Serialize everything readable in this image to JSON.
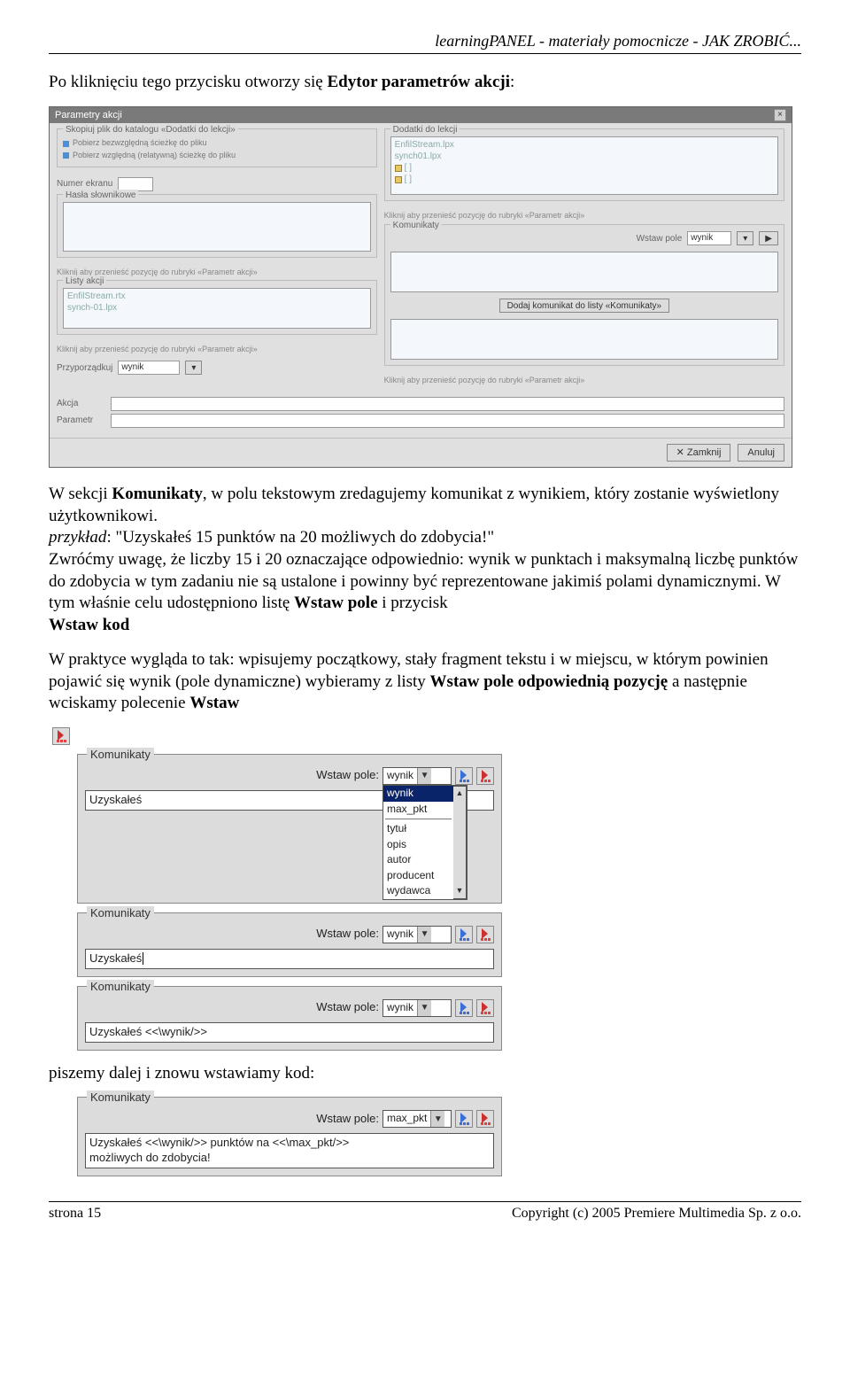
{
  "header": "learningPANEL - materiały pomocnicze - JAK ZROBIĆ...",
  "p1_a": "Po kliknięciu tego przycisku otworzy się ",
  "p1_b": "Edytor parametrów akcji",
  "p1_c": ":",
  "editor": {
    "title": "Parametry akcji",
    "close": "×",
    "left": {
      "g1_legend": "Skopiuj plik do katalogu «Dodatki do lekcji»",
      "g1_item1": "Pobierz bezwzględną ścieżkę do pliku",
      "g1_item2": "Pobierz względną (relatywną) ścieżkę do pliku",
      "numer_label": "Numer ekranu",
      "hasla_legend": "Hasła słownikowe",
      "hint_param": "Kliknij aby przenieść pozycję do rubryki «Parametr akcji»",
      "listy_legend": "Listy akcji",
      "listy_i1": "EnfilStream.rtx",
      "listy_i2": "synch-01.lpx",
      "przyp_label": "Przyporządkuj",
      "przyp_val": "wynik"
    },
    "right": {
      "dodatki_legend": "Dodatki do lekcji",
      "d_i1": "EnfilStream.lpx",
      "d_i2": "synch01.lpx",
      "d_i3": "[ ]",
      "d_i4": "[ ]",
      "hint_param": "Kliknij aby przenieść pozycję do rubryki «Parametr akcji»",
      "kom_legend": "Komunikaty",
      "wstaw_label": "Wstaw pole",
      "wstaw_val": "wynik",
      "dodaj_btn": "Dodaj komunikat do listy «Komunikaty»"
    },
    "bottom": {
      "akcja": "Akcja",
      "parametr": "Parametr",
      "cancel": "✕ Zamknij",
      "ok": "Anuluj"
    }
  },
  "p2_a": "W sekcji ",
  "p2_b": "Komunikaty",
  "p2_c": ", w polu tekstowym zredagujemy komunikat z wynikiem, który zostanie wyświetlony użytkownikowi.",
  "p3_a": "przykład",
  "p3_b": ": \"Uzyskałeś 15 punktów na 20 możliwych do zdobycia!\"",
  "p4": "Zwróćmy uwagę, że liczby 15 i 20 oznaczające odpowiednio: wynik w punktach i maksymalną liczbę punktów do zdobycia w tym zadaniu nie są ustalone i powinny być reprezentowane jakimiś polami dynamicznymi. W tym właśnie celu udostępniono listę ",
  "p4_b": "Wstaw pole",
  "p4_c": " i przycisk ",
  "p4_d": "Wstaw kod",
  "p5": "W praktyce wygląda to tak: wpisujemy początkowy, stały fragment tekstu i w miejscu, w którym powinien pojawić się wynik (pole dynamiczne) wybieramy z listy ",
  "p5_b": "Wstaw pole odpowiednią pozycję",
  "p5_c": " a  następnie wciskamy polecenie ",
  "p5_d": "Wstaw",
  "panel1": {
    "legend": "Komunikaty",
    "label": "Wstaw pole:",
    "sel": "wynik",
    "text": "Uzyskałeś",
    "opts": [
      "wynik",
      "max_pkt",
      "--sep--",
      "tytuł",
      "opis",
      "autor",
      "producent",
      "wydawca"
    ]
  },
  "panel2": {
    "legend": "Komunikaty",
    "label": "Wstaw pole:",
    "sel": "wynik",
    "text": "Uzyskałeś"
  },
  "panel3": {
    "legend": "Komunikaty",
    "label": "Wstaw pole:",
    "sel": "wynik",
    "text": "Uzyskałeś <<\\wynik/>>"
  },
  "p6": "piszemy dalej i znowu wstawiamy kod:",
  "panel4": {
    "legend": "Komunikaty",
    "label": "Wstaw pole:",
    "sel": "max_pkt",
    "line1": "Uzyskałeś <<\\wynik/>> punktów na <<\\max_pkt/>>",
    "line2": "możliwych do zdobycia!"
  },
  "footer": {
    "left": "strona 15",
    "right": "Copyright (c) 2005 Premiere Multimedia Sp. z o.o."
  }
}
